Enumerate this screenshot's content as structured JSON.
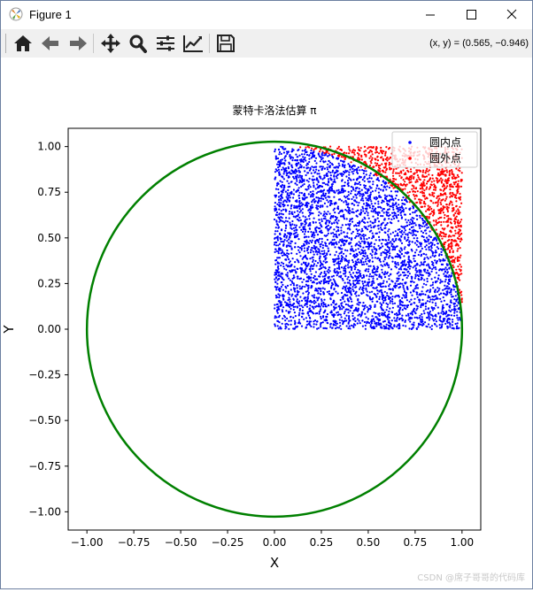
{
  "window": {
    "title": "Figure 1"
  },
  "toolbar": {
    "buttons": [
      "home-icon",
      "back-arrow-icon",
      "forward-arrow-icon",
      "pan-icon",
      "zoom-icon",
      "subplots-icon",
      "edit-axis-icon",
      "save-icon"
    ],
    "coords": "(x, y) = (0.565, −0.946)"
  },
  "chart_data": {
    "type": "scatter",
    "title": "蒙特卡洛法估算 π",
    "xlabel": "X",
    "ylabel": "Y",
    "xlim": [
      -1.1,
      1.1
    ],
    "ylim": [
      -1.1,
      1.1
    ],
    "xticks": [
      "−1.00",
      "−0.75",
      "−0.50",
      "−0.25",
      "0.00",
      "0.25",
      "0.50",
      "0.75",
      "1.00"
    ],
    "xtick_values": [
      -1.0,
      -0.75,
      -0.5,
      -0.25,
      0.0,
      0.25,
      0.5,
      0.75,
      1.0
    ],
    "yticks": [
      "1.00",
      "0.75",
      "0.50",
      "0.25",
      "0.00",
      "−0.25",
      "−0.50",
      "−0.75",
      "−1.00"
    ],
    "ytick_values": [
      1.0,
      0.75,
      0.5,
      0.25,
      0.0,
      -0.25,
      -0.5,
      -0.75,
      -1.0
    ],
    "series": [
      {
        "name": "圆内点",
        "color": "#0000ff",
        "region": "x in [0,1], y in [0,1], x²+y² ≤ 1"
      },
      {
        "name": "圆外点",
        "color": "#ff0000",
        "region": "x in [0,1], y in [0,1], x²+y² > 1"
      }
    ],
    "circle": {
      "center": [
        0,
        0
      ],
      "radius": 1.0,
      "color": "#008000"
    },
    "legend_position": "top-right",
    "grid": false
  },
  "watermark": "CSDN @席子哥哥的代码库"
}
